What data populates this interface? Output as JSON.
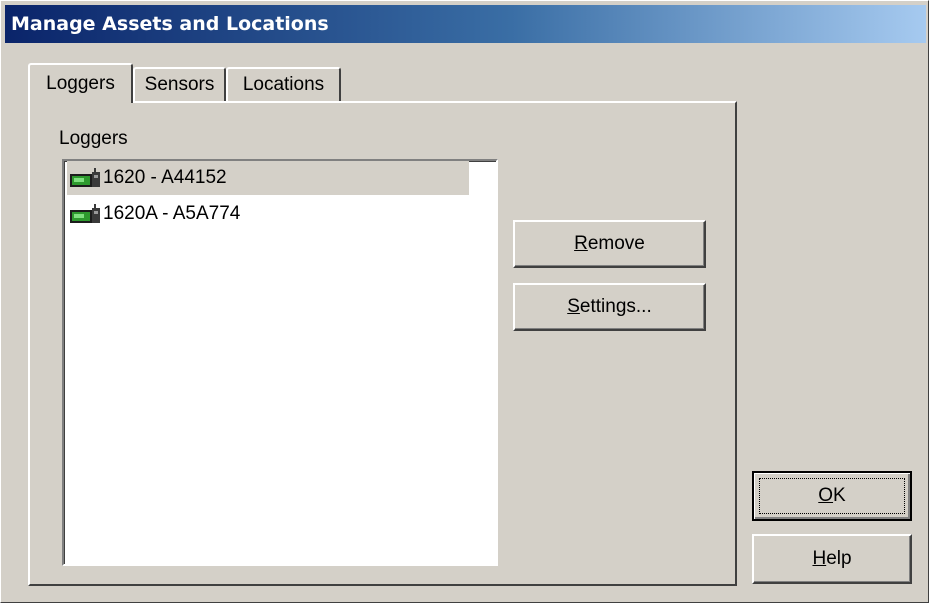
{
  "window": {
    "title": "Manage Assets and Locations"
  },
  "tabs": [
    {
      "label": "Loggers",
      "active": true
    },
    {
      "label": "Sensors",
      "active": false
    },
    {
      "label": "Locations",
      "active": false
    }
  ],
  "loggers_panel": {
    "group_label": "Loggers",
    "items": [
      {
        "label": "1620 - A44152",
        "icon": "logger-device-icon",
        "selected": true
      },
      {
        "label": "1620A - A5A774",
        "icon": "logger-device-icon",
        "selected": false
      }
    ]
  },
  "buttons": {
    "remove": {
      "mnemonic": "R",
      "rest": "emove"
    },
    "settings": {
      "mnemonic": "S",
      "rest": "ettings..."
    },
    "ok": {
      "mnemonic": "O",
      "rest": "K"
    },
    "help": {
      "mnemonic": "H",
      "rest": "elp"
    }
  },
  "colors": {
    "title_gradient_start": "#0a246a",
    "title_gradient_end": "#a6caf0",
    "dialog_face": "#d4d0c8",
    "selection": "#d4d0c8"
  }
}
